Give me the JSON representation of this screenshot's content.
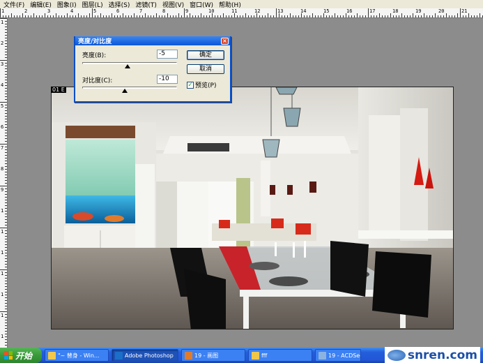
{
  "menu": [
    "文件(F)",
    "编辑(E)",
    "图象(I)",
    "图层(L)",
    "选择(S)",
    "滤镜(T)",
    "视图(V)",
    "窗口(W)",
    "帮助(H)"
  ],
  "ruler_top_numbers": [
    "1",
    "2",
    "3",
    "4",
    "5",
    "6",
    "7",
    "8",
    "9",
    "10",
    "11",
    "12",
    "13",
    "14",
    "15",
    "16",
    "17",
    "18",
    "19",
    "20",
    "21"
  ],
  "ruler_left_numbers": [
    "1",
    "2",
    "3",
    "4",
    "5",
    "6",
    "7",
    "8",
    "9",
    "10",
    "11",
    "12",
    "13",
    "14",
    "15",
    "16"
  ],
  "canvas": {
    "tag": "01 E"
  },
  "dialog": {
    "title": "亮度/对比度",
    "close": "×",
    "brightness_label": "亮度(B):",
    "brightness_value": "-5",
    "brightness_level": 0.48,
    "contrast_label": "对比度(C):",
    "contrast_value": "-10",
    "contrast_level": 0.45,
    "ok_label": "确定",
    "cancel_label": "取消",
    "preview_label": "预览(P)",
    "preview_checked": true
  },
  "taskbar": {
    "start_label": "开始",
    "tasks": [
      {
        "label": "\"~ 替身 - Win...",
        "icon_color": "#f2c94c"
      },
      {
        "label": "Adobe Photoshop",
        "icon_color": "#1b6fc9"
      },
      {
        "label": "19 - 画图",
        "icon_color": "#e07b2c"
      },
      {
        "label": "fff",
        "icon_color": "#f0c64a"
      },
      {
        "label": "19 - ACDSee",
        "icon_color": "#8bb3e0"
      }
    ]
  },
  "watermark": "snren.com",
  "colors": {
    "taskbar_blue": "#245edb",
    "dialog_title": "#0a56d8",
    "start_green": "#3a9a3a"
  }
}
